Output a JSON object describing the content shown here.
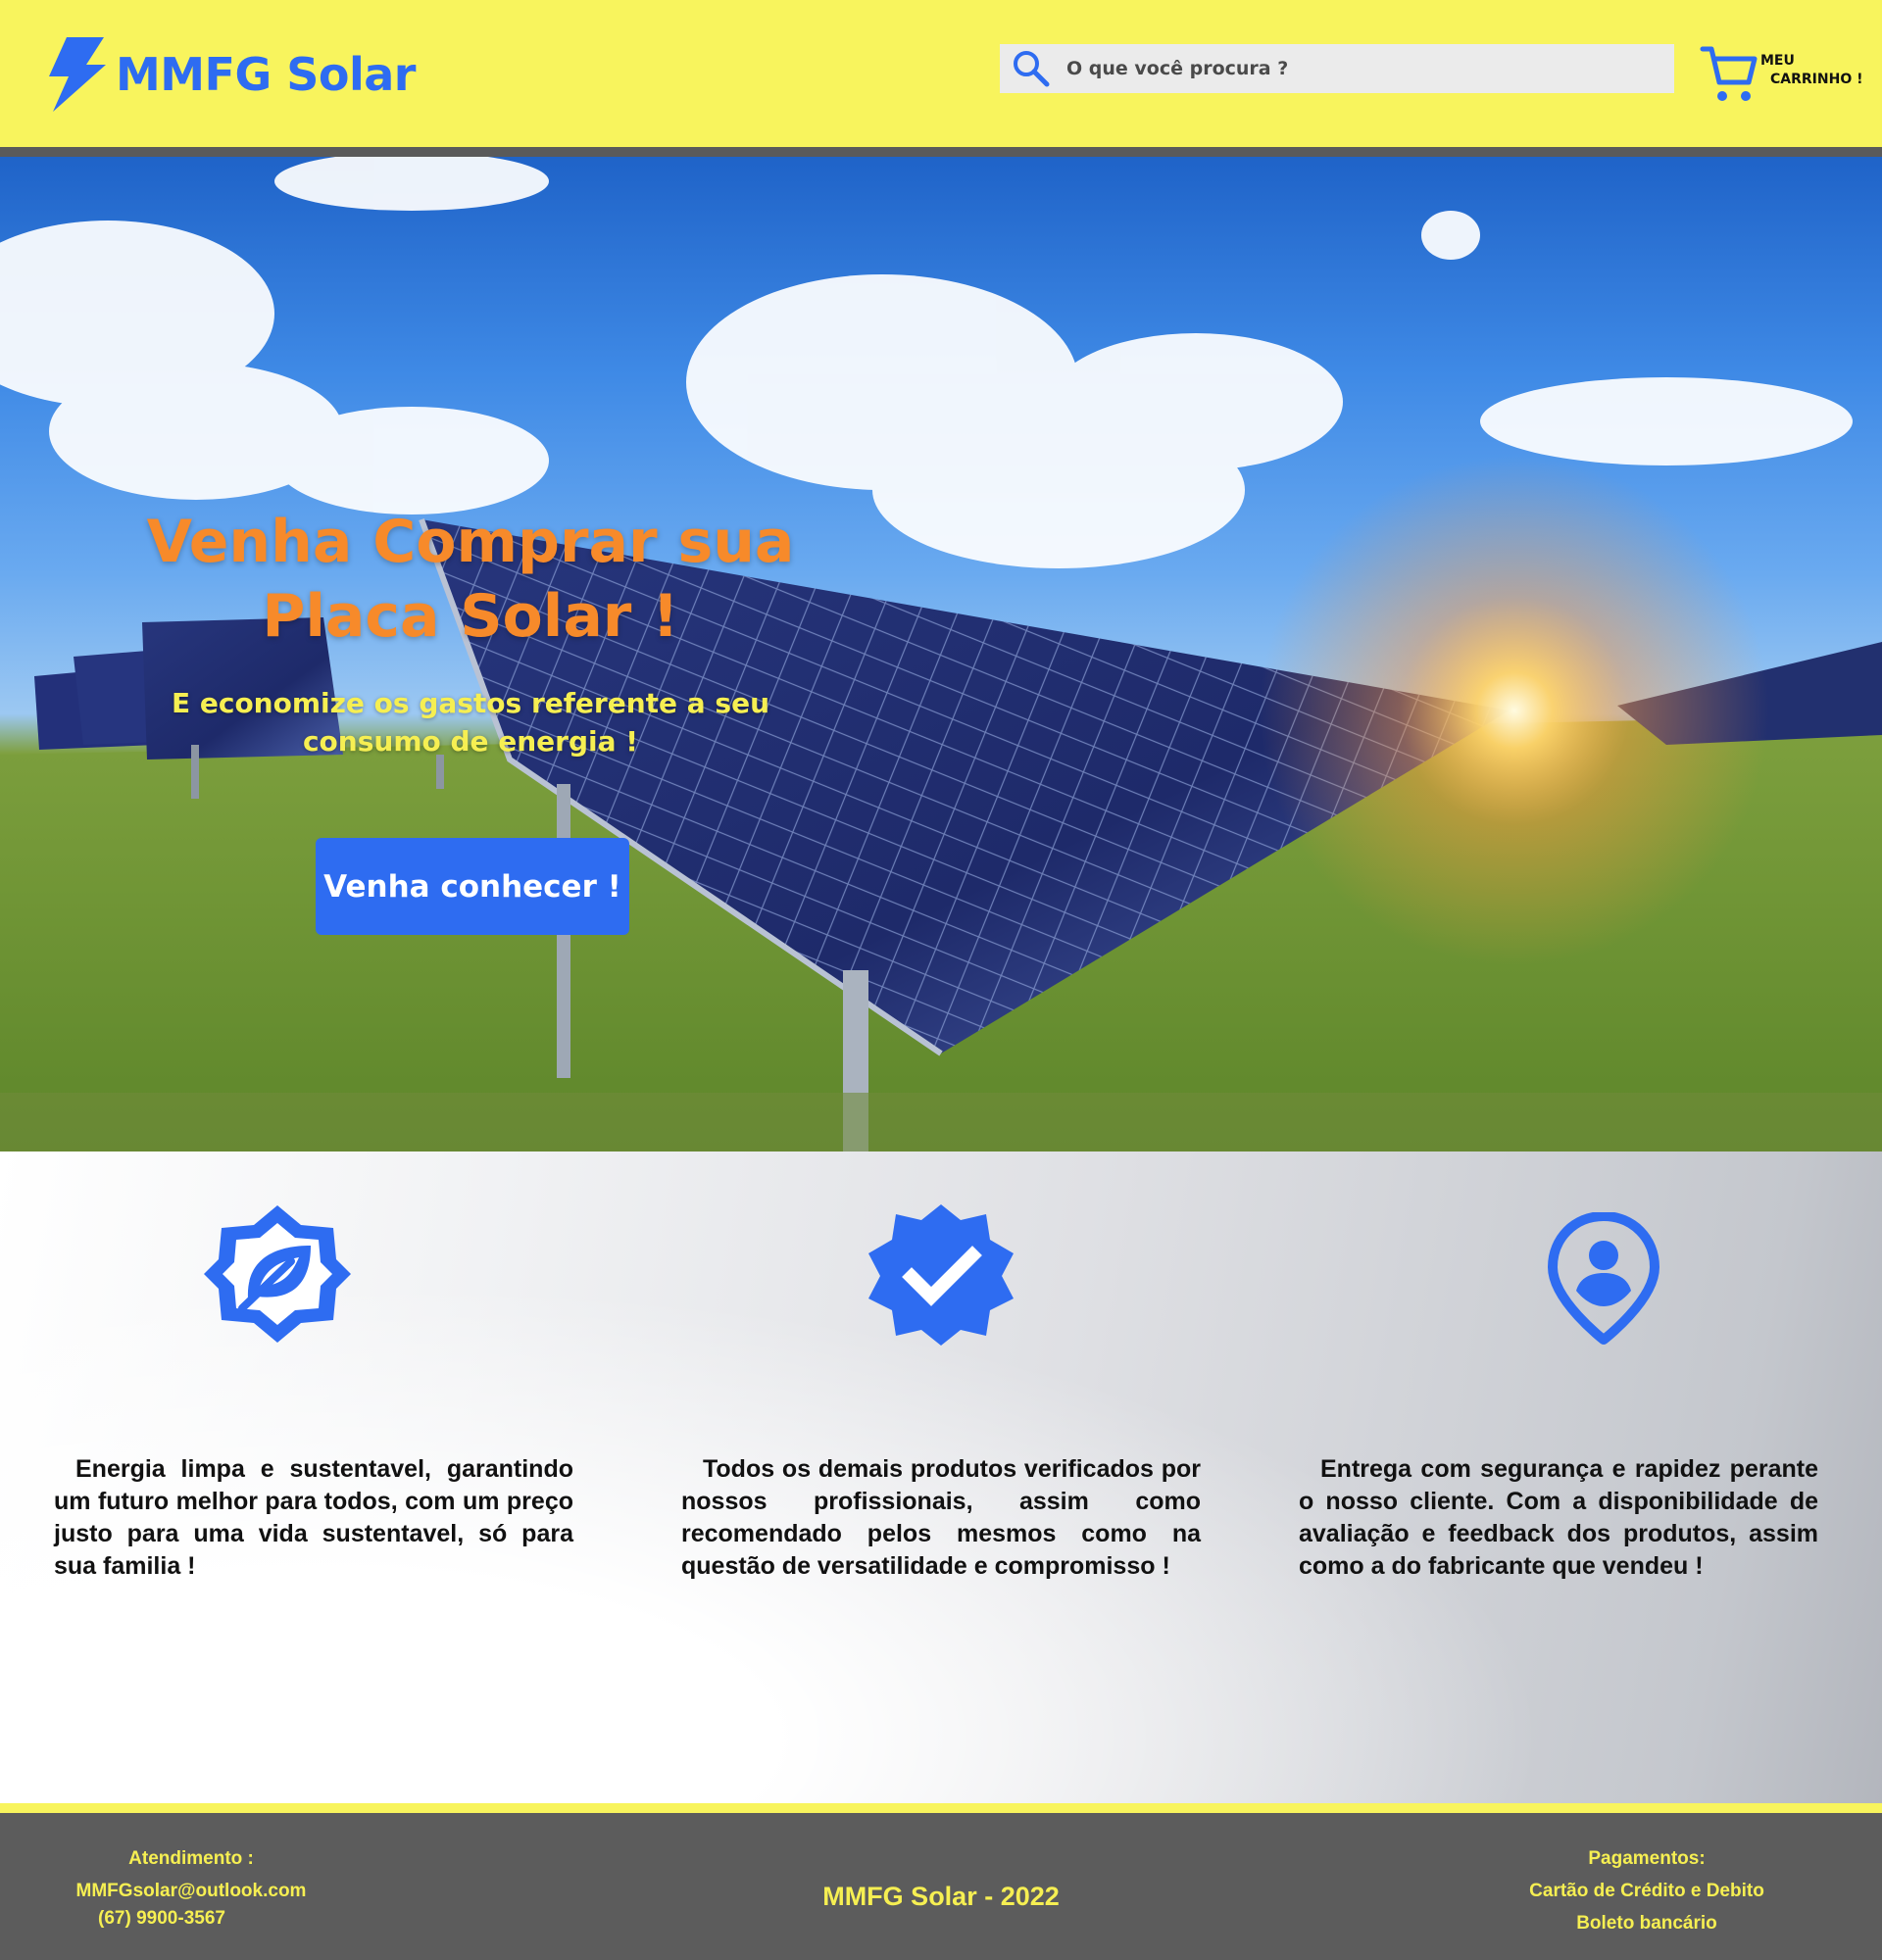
{
  "header": {
    "brand": "MMFG Solar",
    "search_placeholder": "O que você procura ?",
    "cart_line1": "MEU",
    "cart_line2": "CARRINHO !"
  },
  "hero": {
    "title": "Venha Comprar sua Placa Solar !",
    "subtitle": "E economize os gastos referente a seu consumo de energia !",
    "button_label": "Venha conhecer !"
  },
  "features": [
    {
      "icon": "eco-leaf-badge-icon",
      "text": "Energia limpa e sustentavel, garantindo um futuro melhor para todos,  com um preço justo para  uma vida sustentavel, só para sua familia  !"
    },
    {
      "icon": "verified-check-badge-icon",
      "text": "Todos os demais produtos verificados por nossos profissionais, assim como recomendado pelos mesmos como  na questão de versatilidade e compromisso !"
    },
    {
      "icon": "person-location-pin-icon",
      "text": "Entrega com segurança e rapidez perante o nosso cliente. Com a disponibilidade de avaliação e feedback dos produtos, assim como a do fabricante que vendeu !"
    }
  ],
  "footer": {
    "contact_title": "Atendimento :",
    "contact_email": "MMFGsolar@outlook.com",
    "contact_phone": "(67) 9900-3567",
    "copyright": "MMFG Solar - 2022",
    "payments_title": "Pagamentos:",
    "payments_1": "Cartão de Crédito e Debito",
    "payments_2": "Boleto bancário"
  },
  "colors": {
    "header_bg": "#f8f45d",
    "brand_blue": "#2e6cf1",
    "hero_title": "#f78a2a",
    "hero_subtitle": "#f6ef52",
    "footer_bg": "#5c5c5c"
  }
}
